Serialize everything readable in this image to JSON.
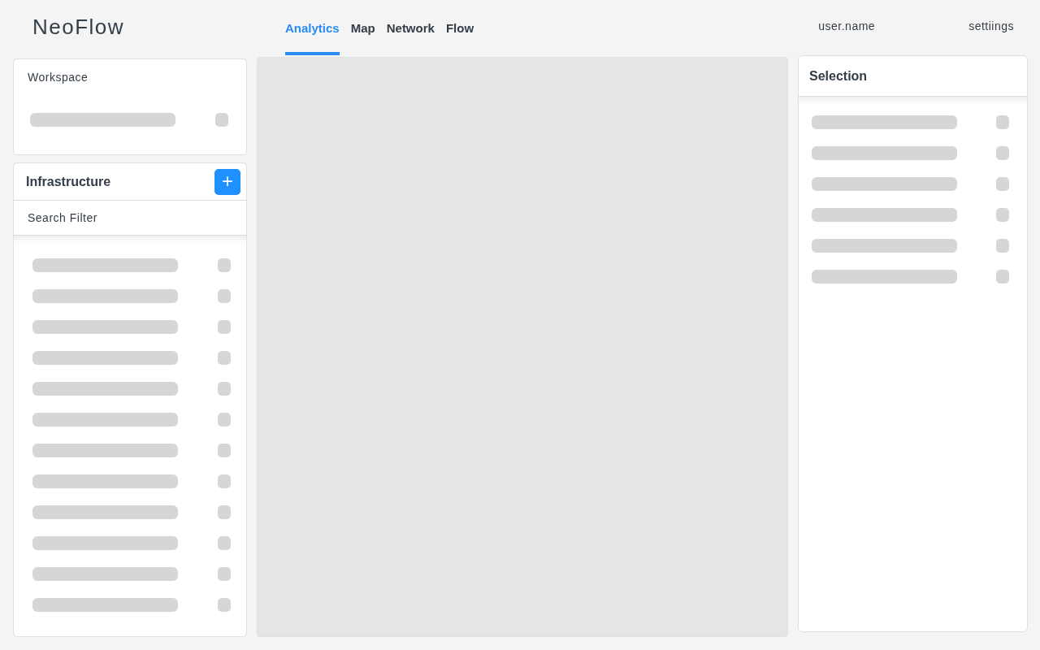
{
  "header": {
    "logo": "NeoFlow",
    "tabs": [
      {
        "label": "Analytics",
        "selected": true
      },
      {
        "label": "Map",
        "selected": false
      },
      {
        "label": "Network",
        "selected": false
      },
      {
        "label": "Flow",
        "selected": false
      }
    ],
    "user": "user.name",
    "settings": "settiings"
  },
  "workspace": {
    "title": "Workspace",
    "rows": [
      {
        "kind": "skeleton"
      }
    ]
  },
  "infrastructure": {
    "title": "Infrastructure",
    "add_button": "+",
    "search": {
      "placeholder": "Search Filter"
    },
    "rows": [
      {
        "kind": "skeleton"
      },
      {
        "kind": "skeleton"
      },
      {
        "kind": "skeleton"
      },
      {
        "kind": "skeleton"
      },
      {
        "kind": "skeleton"
      },
      {
        "kind": "skeleton"
      },
      {
        "kind": "skeleton"
      },
      {
        "kind": "skeleton"
      },
      {
        "kind": "skeleton"
      },
      {
        "kind": "skeleton"
      },
      {
        "kind": "skeleton"
      },
      {
        "kind": "skeleton"
      }
    ]
  },
  "selection": {
    "title": "Selection",
    "rows": [
      {
        "kind": "skeleton"
      },
      {
        "kind": "skeleton"
      },
      {
        "kind": "skeleton"
      },
      {
        "kind": "skeleton"
      },
      {
        "kind": "skeleton"
      },
      {
        "kind": "skeleton"
      }
    ]
  }
}
